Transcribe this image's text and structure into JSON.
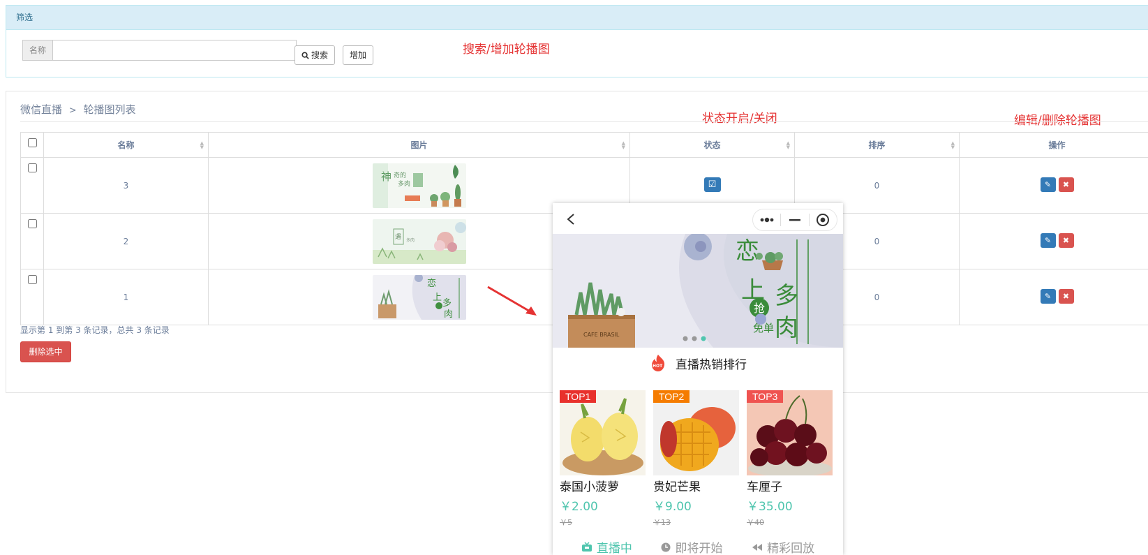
{
  "filter": {
    "title": "筛选",
    "name_label": "名称",
    "name_value": "",
    "search_label": "搜索",
    "add_label": "增加"
  },
  "annotations": {
    "search_add": "搜索/增加轮播图",
    "status_toggle": "状态开启/关闭",
    "edit_delete": "编辑/删除轮播图"
  },
  "breadcrumb": {
    "parent": "微信直播",
    "separator": ">",
    "current": "轮播图列表"
  },
  "table": {
    "headers": {
      "name": "名称",
      "image": "图片",
      "status": "状态",
      "order": "排序",
      "actions": "操作"
    },
    "rows": [
      {
        "name": "3",
        "order": "0",
        "image": "succulent-banner-green",
        "status_checked": true
      },
      {
        "name": "2",
        "order": "0",
        "image": "succulent-banner-pastel",
        "status_checked": true
      },
      {
        "name": "1",
        "order": "0",
        "image": "succulent-banner-crate",
        "status_checked": true
      }
    ]
  },
  "pager_info": "显示第 1 到第 3 条记录，总共 3 条记录",
  "delete_selected_label": "删除选中",
  "phone": {
    "hot_label": "直播热销排行",
    "banner_text": {
      "line1": "恋",
      "line2": "上",
      "line3": "多",
      "line4": "肉",
      "grab": "抢",
      "free": "免单",
      "crate": "CAFE BRASIL"
    },
    "products": [
      {
        "rank": "TOP1",
        "name": "泰国小菠萝",
        "price": "￥2.00",
        "original": "￥5",
        "tag_color": "#e8312c"
      },
      {
        "rank": "TOP2",
        "name": "贵妃芒果",
        "price": "￥9.00",
        "original": "￥13",
        "tag_color": "#f57c00"
      },
      {
        "rank": "TOP3",
        "name": "车厘子",
        "price": "￥35.00",
        "original": "￥40",
        "tag_color": "#ef5350"
      }
    ],
    "tabs": [
      {
        "label": "直播中",
        "icon": "tv-icon",
        "active": true
      },
      {
        "label": "即将开始",
        "icon": "clock-icon",
        "active": false
      },
      {
        "label": "精彩回放",
        "icon": "rewind-icon",
        "active": false
      }
    ]
  },
  "colors": {
    "accent": "#337ab7",
    "danger": "#d9534f",
    "teal": "#4fc5ae",
    "annotation": "#e53333"
  }
}
